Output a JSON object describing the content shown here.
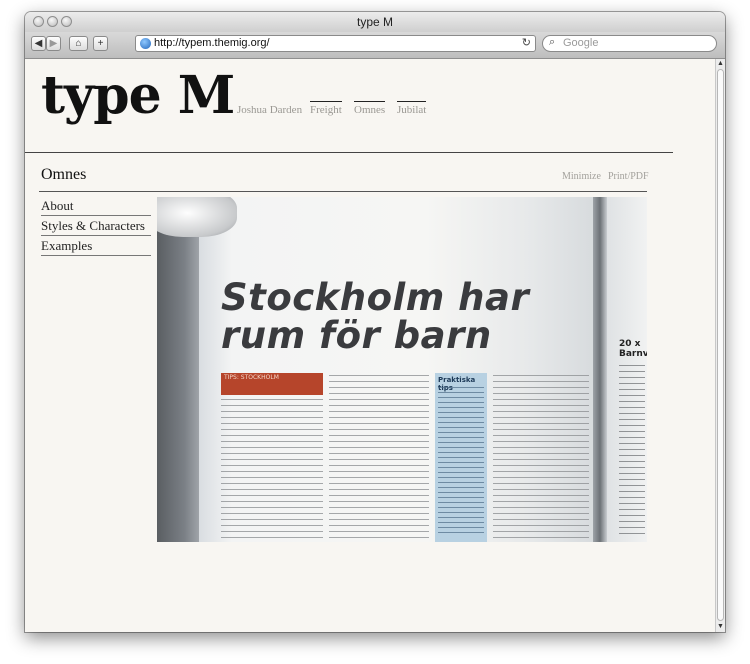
{
  "window": {
    "title": "type M"
  },
  "toolbar": {
    "back_icon": "back-arrow",
    "forward_icon": "forward-arrow",
    "home_icon": "home",
    "add_icon": "plus",
    "url": "http://typem.themig.org/",
    "reload_icon": "reload",
    "search_placeholder": "Google"
  },
  "site": {
    "logo": "type M",
    "nav": [
      {
        "label": "Joshua Darden",
        "active": false
      },
      {
        "label": "Freight",
        "active": true
      },
      {
        "label": "Omnes",
        "active": true
      },
      {
        "label": "Jubilat",
        "active": true
      }
    ]
  },
  "section": {
    "title": "Omnes",
    "tools": [
      "Minimize",
      "Print/PDF"
    ]
  },
  "sidebar": {
    "links": [
      "About",
      "Styles & Characters",
      "Examples"
    ]
  },
  "photo": {
    "headline_line1": "Stockholm har",
    "headline_line2": "rum för barn",
    "tag": "TIPS: STOCKHOLM",
    "tips_title": "Praktiska tips",
    "side_heading": "20 x\nBarnv"
  },
  "colors": {
    "page_bg": "#f8f6f2",
    "nav_text": "#9a9893",
    "accent_red": "#b6452b",
    "tips_blue": "#b8d1e2"
  }
}
